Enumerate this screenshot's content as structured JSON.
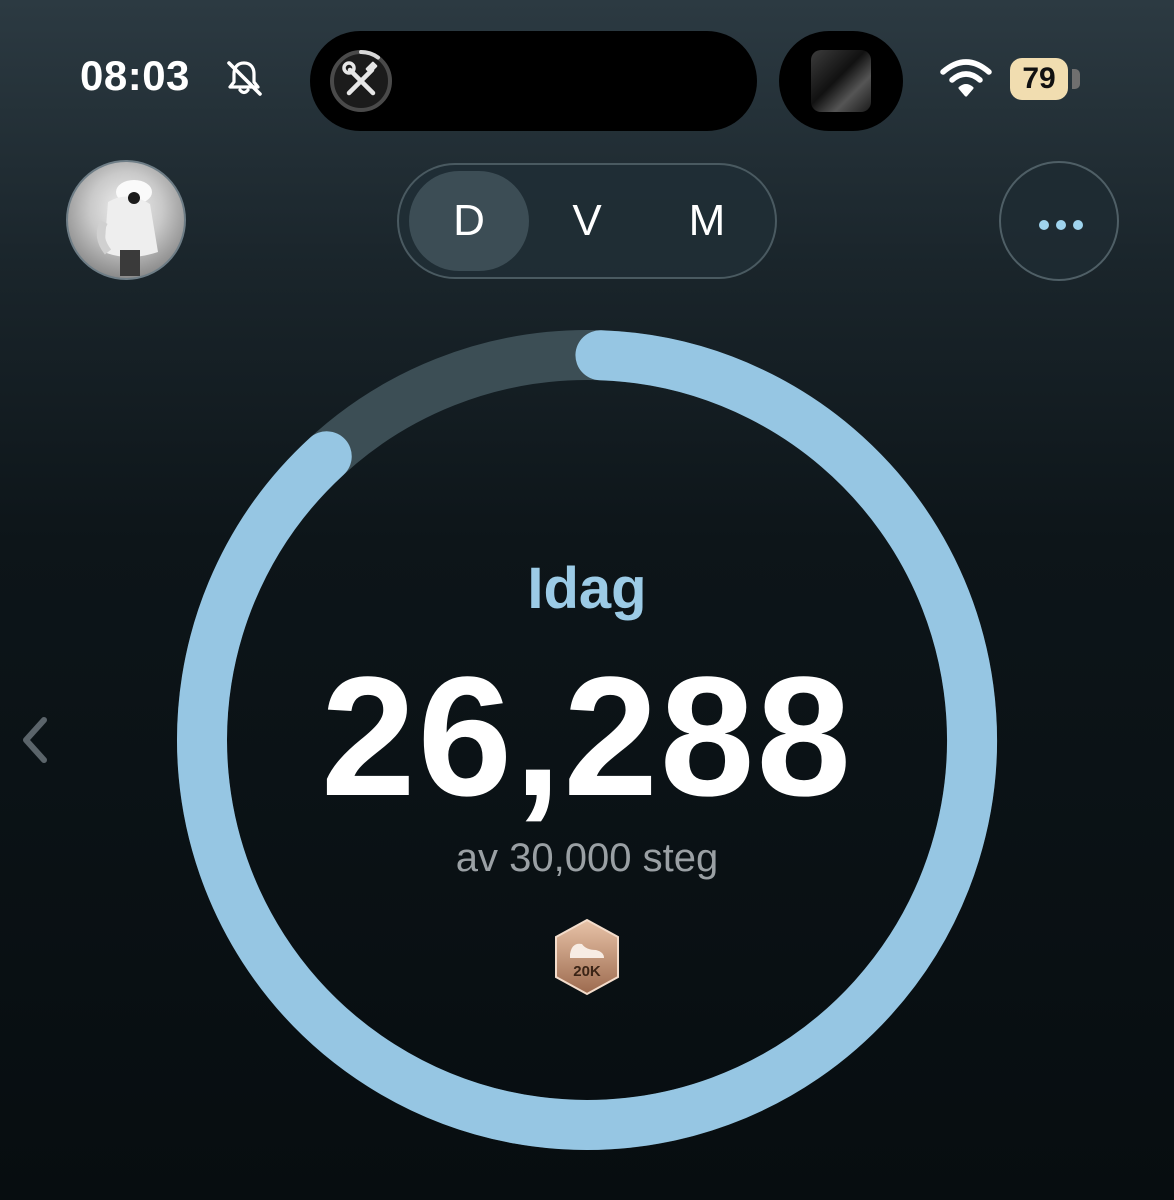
{
  "status_bar": {
    "time": "08:03",
    "battery": "79",
    "icons": [
      "bell-slash-icon",
      "tools-icon",
      "wifi-icon",
      "battery-icon"
    ]
  },
  "header": {
    "segments": [
      {
        "label": "D",
        "active": true
      },
      {
        "label": "V",
        "active": false
      },
      {
        "label": "M",
        "active": false
      }
    ],
    "more_icon": "ellipsis-icon"
  },
  "ring": {
    "title": "Idag",
    "steps": "26,288",
    "goal_text": "av 30,000 steg",
    "progress": 0.8763,
    "badge_label": "20K",
    "badge_icon": "shoe-icon"
  },
  "colors": {
    "ring_fill": "#96c6e3",
    "ring_track": "#3c4e55",
    "title": "#9ccbe6",
    "battery": "#f1ddb0",
    "badge": "#c99a7c"
  }
}
